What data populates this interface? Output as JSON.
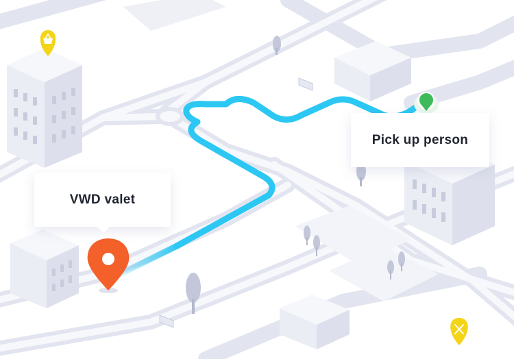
{
  "colors": {
    "route": "#2cc7f3",
    "destination_pin": "#f4602a",
    "pickup_pin": "#3dbb5a",
    "poi_pin": "#f3d417",
    "road": "#e7e9f2",
    "road_edge": "#d9dcea",
    "building_front": "#ebedf5",
    "building_side": "#dde0ec",
    "building_top": "#f6f7fb",
    "window": "#c7cbdc",
    "tree": "#bfc3d6"
  },
  "destination_label": "VWD valet",
  "pickup_label": "Pick up person",
  "icons": {
    "destination": "location-pin-icon",
    "pickup": "pickup-point-icon",
    "shop": "shopping-basket-icon",
    "restaurant": "fork-knife-icon"
  }
}
